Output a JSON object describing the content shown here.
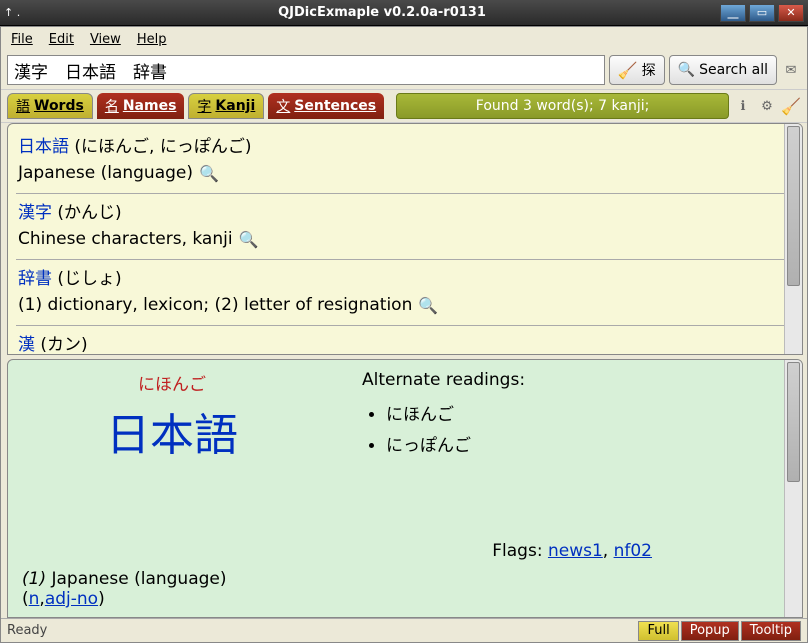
{
  "title": "QJDicExmaple v0.2.0a-r0131",
  "titleleft": "↑ .",
  "menu": {
    "file": "File",
    "edit": "Edit",
    "view": "View",
    "help": "Help"
  },
  "search": {
    "value": "漢字　日本語　辞書",
    "explore_label": "探",
    "searchall_label": "Search all"
  },
  "tabs": [
    {
      "jc": "語",
      "label": "Words"
    },
    {
      "jc": "名",
      "label": "Names"
    },
    {
      "jc": "字",
      "label": "Kanji"
    },
    {
      "jc": "文",
      "label": "Sentences"
    }
  ],
  "found_status": "Found 3 word(s); 7 kanji;",
  "entries": [
    {
      "word": "日本語",
      "reading": "(にほんご, にっぽんご)",
      "def": "Japanese (language)"
    },
    {
      "word": "漢字",
      "reading": "(かんじ)",
      "def": "Chinese characters, kanji"
    },
    {
      "word": "辞書",
      "reading": "(じしょ)",
      "def": "(1) dictionary, lexicon; (2) letter of resignation"
    },
    {
      "word": "漢",
      "reading": "(カン)",
      "def": ""
    }
  ],
  "detail": {
    "reading": "にほんご",
    "word": "日本語",
    "alt_label": "Alternate readings:",
    "alts": [
      "にほんご",
      "にっぽんご"
    ],
    "flags_label": "Flags: ",
    "flags": [
      "news1",
      "nf02"
    ],
    "defnum": "(1)",
    "def": "Japanese (language)",
    "pos_open": "(",
    "pos1": "n",
    "pos_sep": ",",
    "pos2": "adj-no",
    "pos_close": ")"
  },
  "status": {
    "ready": "Ready",
    "full": "Full",
    "popup": "Popup",
    "tooltip": "Tooltip"
  }
}
